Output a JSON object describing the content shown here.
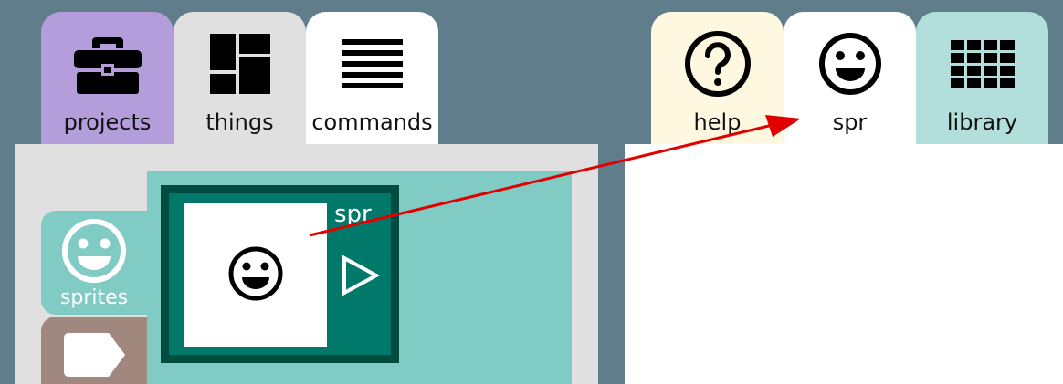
{
  "tabs": {
    "projects": {
      "label": "projects",
      "icon": "briefcase-icon"
    },
    "things": {
      "label": "things",
      "icon": "dashboard-icon"
    },
    "commands": {
      "label": "commands",
      "icon": "lines-icon"
    },
    "help": {
      "label": "help",
      "icon": "help-circle-icon"
    },
    "spr": {
      "label": "spr",
      "icon": "smiley-icon"
    },
    "library": {
      "label": "library",
      "icon": "grid-icon"
    }
  },
  "side_tabs": {
    "sprites": {
      "label": "sprites",
      "icon": "smiley-icon"
    },
    "tags": {
      "icon": "tag-icon"
    }
  },
  "sprite_card": {
    "name": "spr",
    "thumbnail_icon": "smiley-icon",
    "play_icon": "play-icon"
  },
  "colors": {
    "background": "#607d8b",
    "projects_tab": "#b39ddb",
    "things_tab": "#e0e0e0",
    "help_tab": "#fff8e1",
    "library_tab": "#b2dfdb",
    "sprites_tab": "#80cbc4",
    "tags_tab": "#a1887f",
    "sprite_card": "#00796b",
    "sprite_card_border": "#004d40",
    "arrow": "#e00000"
  }
}
